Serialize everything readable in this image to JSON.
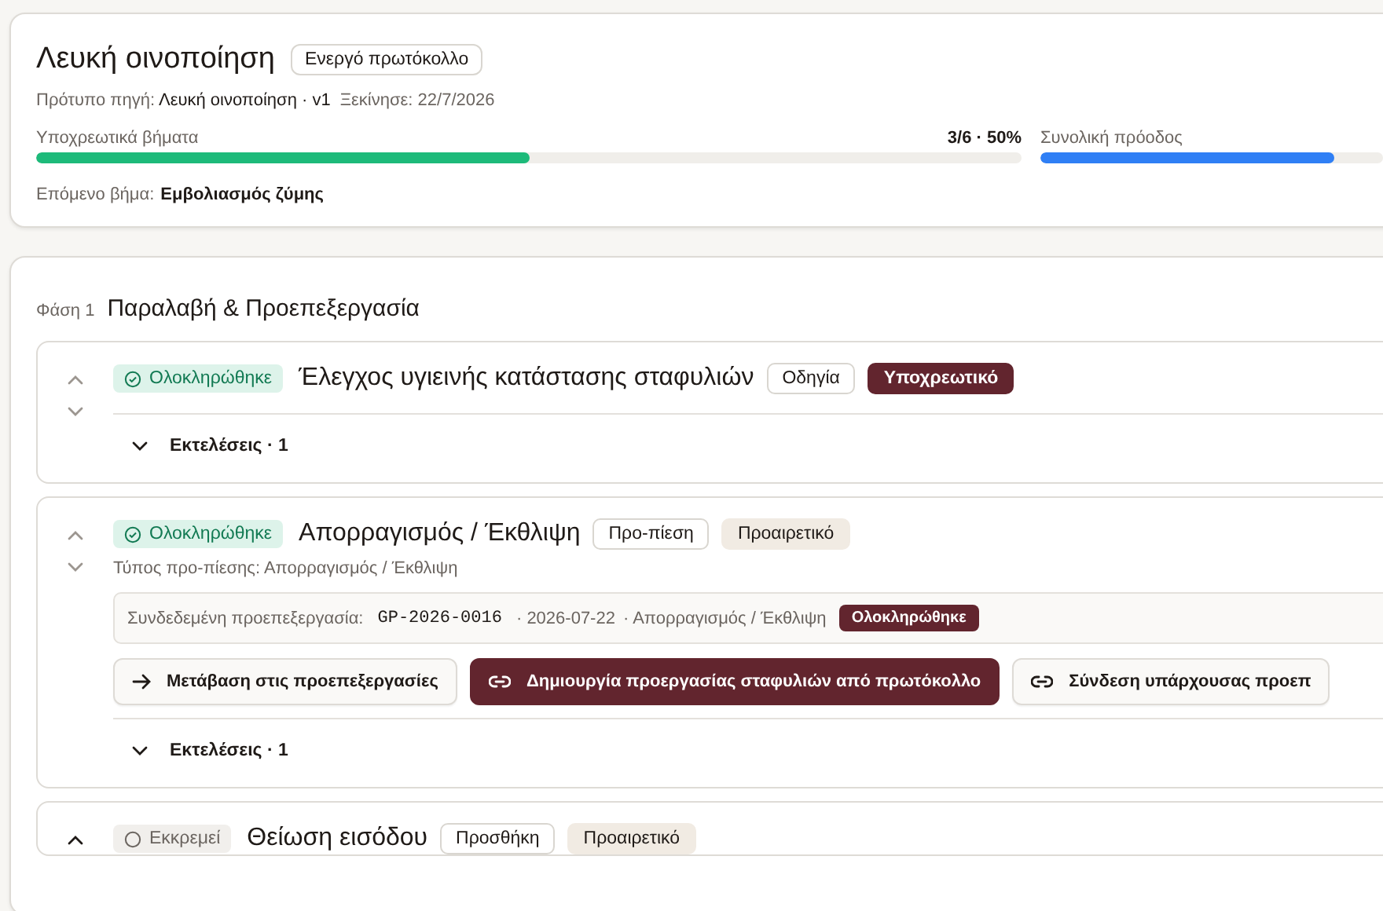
{
  "protocol": {
    "title": "Λευκή οινοποίηση",
    "badge": "Ενεργό πρωτόκολλο",
    "source_label": "Πρότυπο πηγή:",
    "source_value": "Λευκή οινοποίηση · v1",
    "started": "Ξεκίνησε: 22/7/2026",
    "required_progress": {
      "label": "Υποχρεωτικά βήματα",
      "reading": "3/6 · 50%",
      "level": 0.5
    },
    "overall_progress": {
      "label": "Συνολική πρόοδος",
      "level": 0.86
    },
    "next_label": "Επόμενο βήμα:",
    "next_value": "Εμβολιασμός ζύμης"
  },
  "phase": {
    "label": "Φάση 1",
    "title": "Παραλαβή & Προεπεξεργασία",
    "steps": [
      {
        "status": {
          "kind": "done",
          "label": "Ολοκληρώθηκε"
        },
        "title": "Έλεγχος υγιεινής κατάστασης σταφυλιών",
        "tags": [
          {
            "kind": "outline",
            "label": "Οδηγία"
          },
          {
            "kind": "dark",
            "label": "Υποχρεωτικό"
          }
        ],
        "executions": {
          "label": "Εκτελέσεις · 1",
          "expanded": false
        }
      },
      {
        "status": {
          "kind": "done",
          "label": "Ολοκληρώθηκε"
        },
        "title": "Απορραγισμός / Έκθλιψη",
        "tags": [
          {
            "kind": "outline",
            "label": "Προ-πίεση"
          },
          {
            "kind": "beige",
            "label": "Προαιρετικό"
          }
        ],
        "subtitle": "Τύπος προ-πίεσης: Απορραγισμός / Έκθλιψη",
        "linked": {
          "label": "Συνδεδεμένη προεπεξεργασία:",
          "code": "GP-2026-0016",
          "date": "· 2026-07-22",
          "type": "· Απορραγισμός / Έκθλιψη",
          "status": "Ολοκληρώθηκε"
        },
        "actions": [
          {
            "kind": "navigate",
            "label": "Μετάβαση στις προεπεξεργασίες"
          },
          {
            "kind": "create",
            "label": "Δημιουργία προεργασίας σταφυλιών από πρωτόκολλο"
          },
          {
            "kind": "connect",
            "label": "Σύνδεση υπάρχουσας προεπ"
          }
        ],
        "executions": {
          "label": "Εκτελέσεις · 1",
          "expanded": false
        }
      },
      {
        "status": {
          "kind": "pending",
          "label": "Εκκρεμεί"
        },
        "title": "Θείωση εισόδου",
        "tags": [
          {
            "kind": "outline",
            "label": "Προσθήκη"
          },
          {
            "kind": "beige",
            "label": "Προαιρετικό"
          }
        ]
      }
    ]
  }
}
